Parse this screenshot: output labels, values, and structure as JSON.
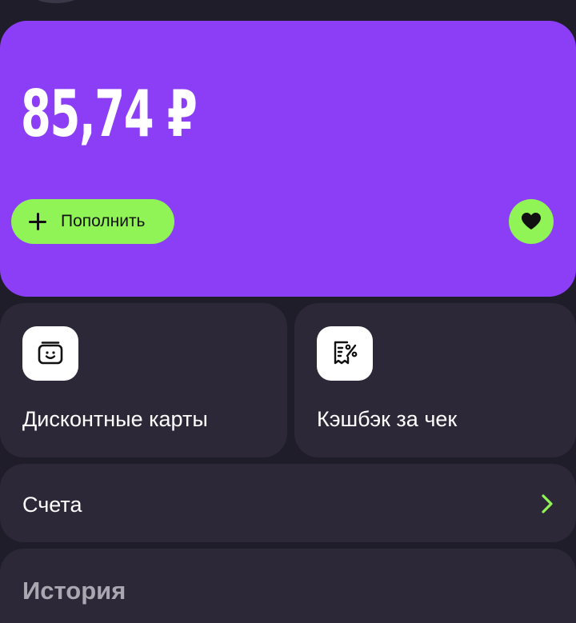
{
  "balance": {
    "amount": "85,74 ₽",
    "topup_label": "Пополнить",
    "background_color": "#8c3ef7",
    "accent_color": "#90f356"
  },
  "tiles": [
    {
      "label": "Дисконтные карты",
      "icon": "discount-card-icon"
    },
    {
      "label": "Кэшбэк за чек",
      "icon": "receipt-percent-icon"
    }
  ],
  "accounts": {
    "label": "Счета",
    "icon": "chevron-right-icon"
  },
  "history": {
    "title": "История"
  },
  "icons": {
    "favorite": "heart-icon",
    "topup": "plus-icon"
  }
}
